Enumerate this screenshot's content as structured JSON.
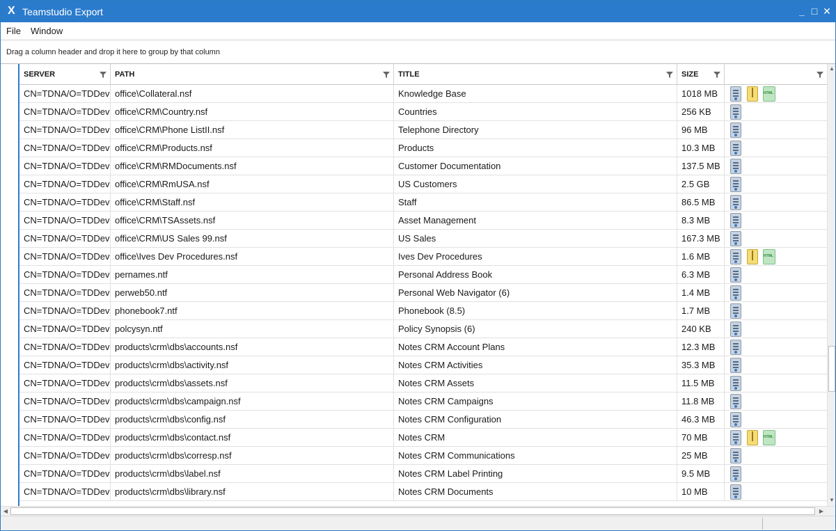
{
  "window": {
    "title": "Teamstudio Export",
    "icon": "teamstudio-x-icon",
    "controls": {
      "minimize": "minimize-icon",
      "maximize": "maximize-icon",
      "close": "close-icon"
    }
  },
  "menu": {
    "items": [
      "File",
      "Window"
    ]
  },
  "group_hint": "Drag a column header and drop it here to group by that column",
  "columns": [
    {
      "label": "SERVER",
      "filter_icon": "filter-icon"
    },
    {
      "label": "PATH",
      "filter_icon": "filter-icon"
    },
    {
      "label": "TITLE",
      "filter_icon": "filter-icon"
    },
    {
      "label": "SIZE",
      "filter_icon": "filter-icon"
    },
    {
      "label": "",
      "filter_icon": "filter-icon"
    }
  ],
  "rows": [
    {
      "server": "CN=TDNA/O=TDDev",
      "path": "office\\Collateral.nsf",
      "title": "Knowledge Base",
      "size": "1018 MB",
      "icons": [
        "database-icon",
        "zip-icon",
        "html-icon"
      ]
    },
    {
      "server": "CN=TDNA/O=TDDev",
      "path": "office\\CRM\\Country.nsf",
      "title": "Countries",
      "size": "256 KB",
      "icons": [
        "database-icon"
      ]
    },
    {
      "server": "CN=TDNA/O=TDDev",
      "path": "office\\CRM\\Phone ListII.nsf",
      "title": "Telephone Directory",
      "size": "96 MB",
      "icons": [
        "database-icon"
      ]
    },
    {
      "server": "CN=TDNA/O=TDDev",
      "path": "office\\CRM\\Products.nsf",
      "title": "Products",
      "size": "10.3 MB",
      "icons": [
        "database-icon"
      ]
    },
    {
      "server": "CN=TDNA/O=TDDev",
      "path": "office\\CRM\\RMDocuments.nsf",
      "title": "Customer Documentation",
      "size": "137.5 MB",
      "icons": [
        "database-icon"
      ]
    },
    {
      "server": "CN=TDNA/O=TDDev",
      "path": "office\\CRM\\RmUSA.nsf",
      "title": "US Customers",
      "size": "2.5 GB",
      "icons": [
        "database-icon"
      ]
    },
    {
      "server": "CN=TDNA/O=TDDev",
      "path": "office\\CRM\\Staff.nsf",
      "title": "Staff",
      "size": "86.5 MB",
      "icons": [
        "database-icon"
      ]
    },
    {
      "server": "CN=TDNA/O=TDDev",
      "path": "office\\CRM\\TSAssets.nsf",
      "title": "Asset Management",
      "size": "8.3 MB",
      "icons": [
        "database-icon"
      ]
    },
    {
      "server": "CN=TDNA/O=TDDev",
      "path": "office\\CRM\\US Sales 99.nsf",
      "title": "US Sales",
      "size": "167.3 MB",
      "icons": [
        "database-icon"
      ]
    },
    {
      "server": "CN=TDNA/O=TDDev",
      "path": "office\\Ives Dev Procedures.nsf",
      "title": "Ives Dev Procedures",
      "size": "1.6 MB",
      "icons": [
        "database-icon",
        "zip-icon",
        "html-icon"
      ]
    },
    {
      "server": "CN=TDNA/O=TDDev",
      "path": "pernames.ntf",
      "title": "Personal Address Book",
      "size": "6.3 MB",
      "icons": [
        "database-icon"
      ]
    },
    {
      "server": "CN=TDNA/O=TDDev",
      "path": "perweb50.ntf",
      "title": "Personal Web Navigator (6)",
      "size": "1.4 MB",
      "icons": [
        "database-icon"
      ]
    },
    {
      "server": "CN=TDNA/O=TDDev",
      "path": "phonebook7.ntf",
      "title": "Phonebook (8.5)",
      "size": "1.7 MB",
      "icons": [
        "database-icon"
      ]
    },
    {
      "server": "CN=TDNA/O=TDDev",
      "path": "polcysyn.ntf",
      "title": "Policy Synopsis (6)",
      "size": "240 KB",
      "icons": [
        "database-icon"
      ]
    },
    {
      "server": "CN=TDNA/O=TDDev",
      "path": "products\\crm\\dbs\\accounts.nsf",
      "title": "Notes CRM Account Plans",
      "size": "12.3 MB",
      "icons": [
        "database-icon"
      ]
    },
    {
      "server": "CN=TDNA/O=TDDev",
      "path": "products\\crm\\dbs\\activity.nsf",
      "title": "Notes CRM Activities",
      "size": "35.3 MB",
      "icons": [
        "database-icon"
      ]
    },
    {
      "server": "CN=TDNA/O=TDDev",
      "path": "products\\crm\\dbs\\assets.nsf",
      "title": "Notes CRM Assets",
      "size": "11.5 MB",
      "icons": [
        "database-icon"
      ]
    },
    {
      "server": "CN=TDNA/O=TDDev",
      "path": "products\\crm\\dbs\\campaign.nsf",
      "title": "Notes CRM Campaigns",
      "size": "11.8 MB",
      "icons": [
        "database-icon"
      ]
    },
    {
      "server": "CN=TDNA/O=TDDev",
      "path": "products\\crm\\dbs\\config.nsf",
      "title": "Notes CRM Configuration",
      "size": "46.3 MB",
      "icons": [
        "database-icon"
      ]
    },
    {
      "server": "CN=TDNA/O=TDDev",
      "path": "products\\crm\\dbs\\contact.nsf",
      "title": "Notes CRM",
      "size": "70 MB",
      "icons": [
        "database-icon",
        "zip-icon",
        "html-icon"
      ]
    },
    {
      "server": "CN=TDNA/O=TDDev",
      "path": "products\\crm\\dbs\\corresp.nsf",
      "title": "Notes CRM Communications",
      "size": "25 MB",
      "icons": [
        "database-icon"
      ]
    },
    {
      "server": "CN=TDNA/O=TDDev",
      "path": "products\\crm\\dbs\\label.nsf",
      "title": "Notes CRM Label Printing",
      "size": "9.5 MB",
      "icons": [
        "database-icon"
      ]
    },
    {
      "server": "CN=TDNA/O=TDDev",
      "path": "products\\crm\\dbs\\library.nsf",
      "title": "Notes CRM Documents",
      "size": "10 MB",
      "icons": [
        "database-icon"
      ]
    }
  ],
  "colors": {
    "titlebar": "#2b7bcc",
    "accent": "#2b7bcc"
  }
}
